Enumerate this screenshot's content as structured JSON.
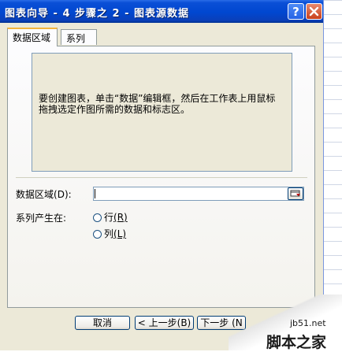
{
  "window": {
    "title": "图表向导 - 4 步骤之 2 - 图表源数据",
    "help_glyph": "?",
    "close_glyph": "×"
  },
  "tabs": [
    {
      "label": "数据区域",
      "active": true
    },
    {
      "label": "系列",
      "active": false
    }
  ],
  "preview": {
    "message_line1": "要创建图表，单击“数据”编辑框，然后在工作表上用鼠标",
    "message_line2": "拖拽选定作图所需的数据和标志区。"
  },
  "data_range": {
    "label_text": "数据区域",
    "label_key": "(D):",
    "value": ""
  },
  "series_in": {
    "label": "系列产生在:",
    "options": [
      {
        "text": "行",
        "key": "(R)",
        "selected": false
      },
      {
        "text": "列",
        "key": "(L)",
        "selected": false
      }
    ]
  },
  "buttons": {
    "cancel": "取消",
    "back": "< 上一步(B)",
    "next": "下一步 (N"
  },
  "watermark": {
    "site": "jb51.net",
    "name": "脚本之家"
  },
  "colors": {
    "titlebar": "#0047d0",
    "dialog_bg": "#ece9d8",
    "active_tab_accent": "#f5b53d"
  }
}
